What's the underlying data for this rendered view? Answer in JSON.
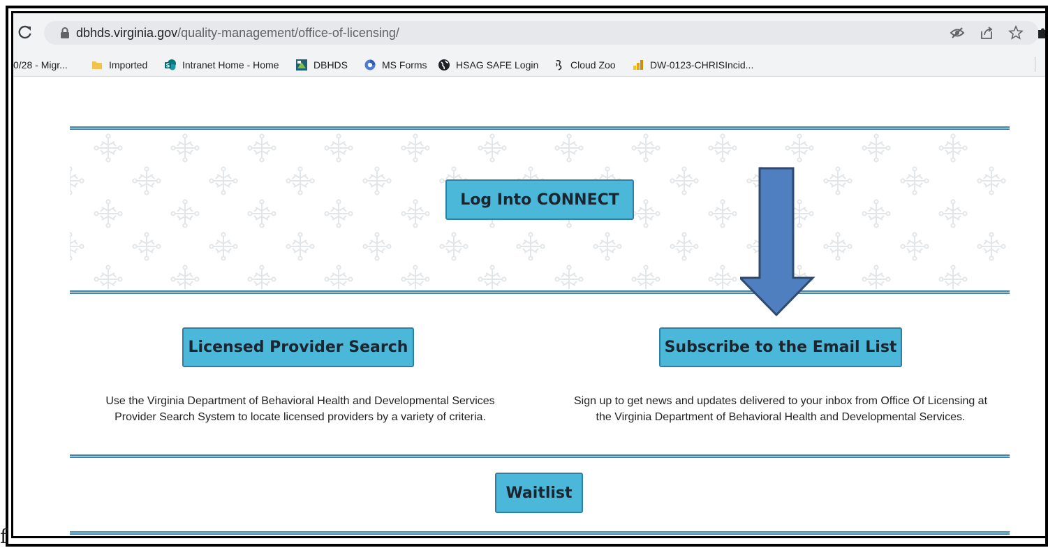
{
  "browser": {
    "url_host": "dbhds.virginia.gov",
    "url_path": "/quality-management/office-of-licensing/",
    "bookmarks": [
      {
        "label": "0/28 - Migr...",
        "icon": "bookmark-page-icon"
      },
      {
        "label": "Imported",
        "icon": "folder-icon"
      },
      {
        "label": "Intranet Home - Home",
        "icon": "sharepoint-icon"
      },
      {
        "label": "DBHDS",
        "icon": "dbhds-icon"
      },
      {
        "label": "MS Forms",
        "icon": "ms-forms-icon"
      },
      {
        "label": "HSAG SAFE Login",
        "icon": "globe-icon"
      },
      {
        "label": "Cloud Zoo",
        "icon": "cloud-zoo-icon"
      },
      {
        "label": "DW-0123-CHRISIncid...",
        "icon": "power-bi-icon"
      }
    ]
  },
  "page": {
    "connect_button": "Log Into CONNECT",
    "provider_search_button": "Licensed Provider Search",
    "provider_search_desc": [
      "Use the Virginia Department of Behavioral Health and Developmental Services",
      "Provider Search System to locate licensed providers by a variety of criteria."
    ],
    "subscribe_button": "Subscribe to the Email List",
    "subscribe_desc": [
      "Sign up to get news and updates delivered to your inbox from Office Of Licensing at",
      "the Virginia Department of Behavioral Health and Developmental Services."
    ],
    "waitlist_button": "Waitlist"
  },
  "annotation": {
    "arrow_color": "#4f7fbf",
    "arrow_outline": "#2f4a6e"
  },
  "stray_text": "f"
}
